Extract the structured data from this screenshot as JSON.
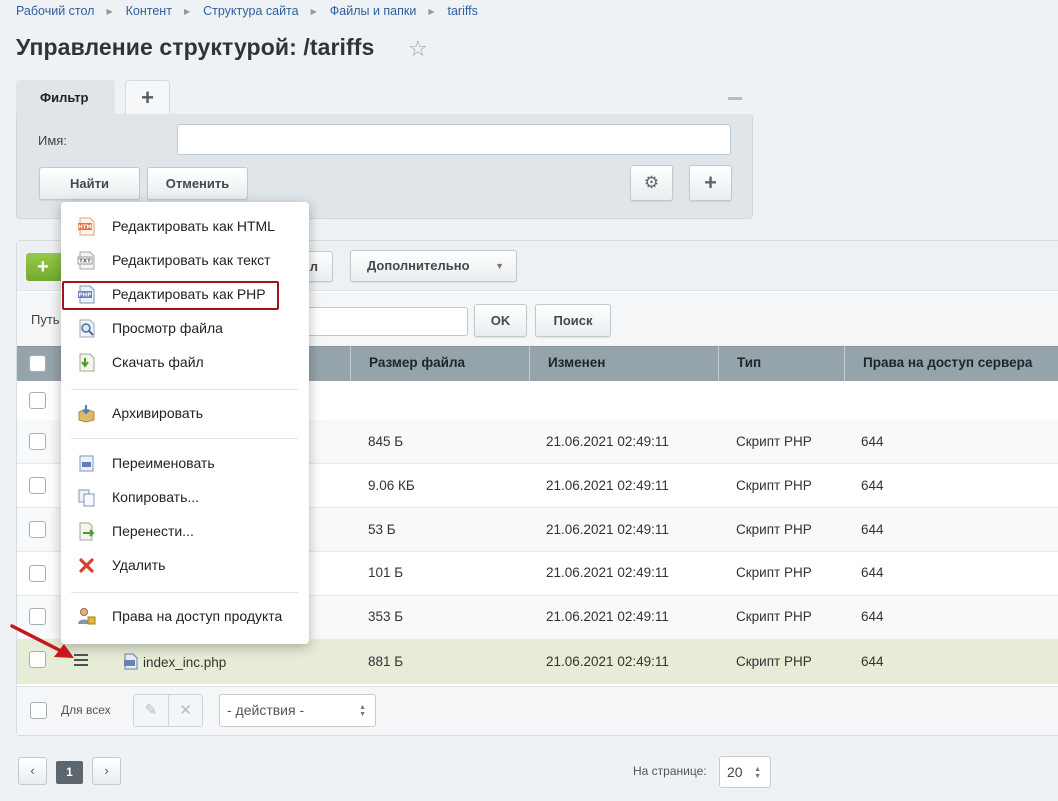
{
  "breadcrumb": [
    "Рабочий стол",
    "Контент",
    "Структура сайта",
    "Файлы и папки",
    "tariffs"
  ],
  "page_title": "Управление структурой: /tariffs",
  "filter": {
    "tab_label": "Фильтр",
    "add_tab_label": "+",
    "name_label": "Имя:",
    "name_value": "",
    "find_label": "Найти",
    "cancel_label": "Отменить",
    "add_label": "+"
  },
  "toolbar": {
    "add_label": "+",
    "hidden_button_tail": "л",
    "more_label": "Дополнительно"
  },
  "path_bar": {
    "label": "Путь",
    "ok_label": "OK",
    "search_label": "Поиск"
  },
  "table": {
    "columns": [
      "Размер файла",
      "Изменен",
      "Тип",
      "Права на доступ сервера"
    ],
    "rows": [
      {
        "size": "",
        "modified": "",
        "type": "",
        "rights": ""
      },
      {
        "size": "845 Б",
        "modified": "21.06.2021 02:49:11",
        "type": "Скрипт PHP",
        "rights": "644"
      },
      {
        "size": "9.06 КБ",
        "modified": "21.06.2021 02:49:11",
        "type": "Скрипт PHP",
        "rights": "644"
      },
      {
        "size": "53 Б",
        "modified": "21.06.2021 02:49:11",
        "type": "Скрипт PHP",
        "rights": "644"
      },
      {
        "size": "101 Б",
        "modified": "21.06.2021 02:49:11",
        "type": "Скрипт PHP",
        "rights": "644"
      },
      {
        "size": "353 Б",
        "modified": "21.06.2021 02:49:11",
        "type": "Скрипт PHP",
        "rights": "644"
      },
      {
        "name": "index_inc.php",
        "size": "881 Б",
        "modified": "21.06.2021 02:49:11",
        "type": "Скрипт PHP",
        "rights": "644"
      }
    ]
  },
  "footer": {
    "all_label": "Для всех",
    "actions_placeholder": "- действия -"
  },
  "pagination": {
    "current_page": "1",
    "prev_icon": "‹",
    "next_icon": "›",
    "per_page_label": "На странице:",
    "per_page_value": "20"
  },
  "context_menu": {
    "items": [
      {
        "label": "Редактировать как HTML",
        "icon": "html-file-icon"
      },
      {
        "label": "Редактировать как текст",
        "icon": "txt-file-icon"
      },
      {
        "label": "Редактировать как PHP",
        "icon": "php-file-icon",
        "highlighted": true
      },
      {
        "label": "Просмотр файла",
        "icon": "magnifier-file-icon"
      },
      {
        "label": "Скачать файл",
        "icon": "download-file-icon"
      },
      {
        "label": "Архивировать",
        "icon": "archive-box-icon"
      },
      {
        "label": "Переименовать",
        "icon": "rename-icon"
      },
      {
        "label": "Копировать...",
        "icon": "copy-icon"
      },
      {
        "label": "Перенести...",
        "icon": "move-icon"
      },
      {
        "label": "Удалить",
        "icon": "delete-cross-icon"
      },
      {
        "label": "Права на доступ продукта",
        "icon": "user-lock-icon"
      }
    ],
    "icon_texts": {
      "html": "HTM",
      "txt": "TXT",
      "php": "PHP"
    }
  },
  "colors": {
    "accent_link": "#2f5f9e",
    "highlight_border": "#a0151a",
    "header_bg": "#95a3ab",
    "selected_row": "#e6ecd5",
    "green_button": "#7fb436"
  }
}
